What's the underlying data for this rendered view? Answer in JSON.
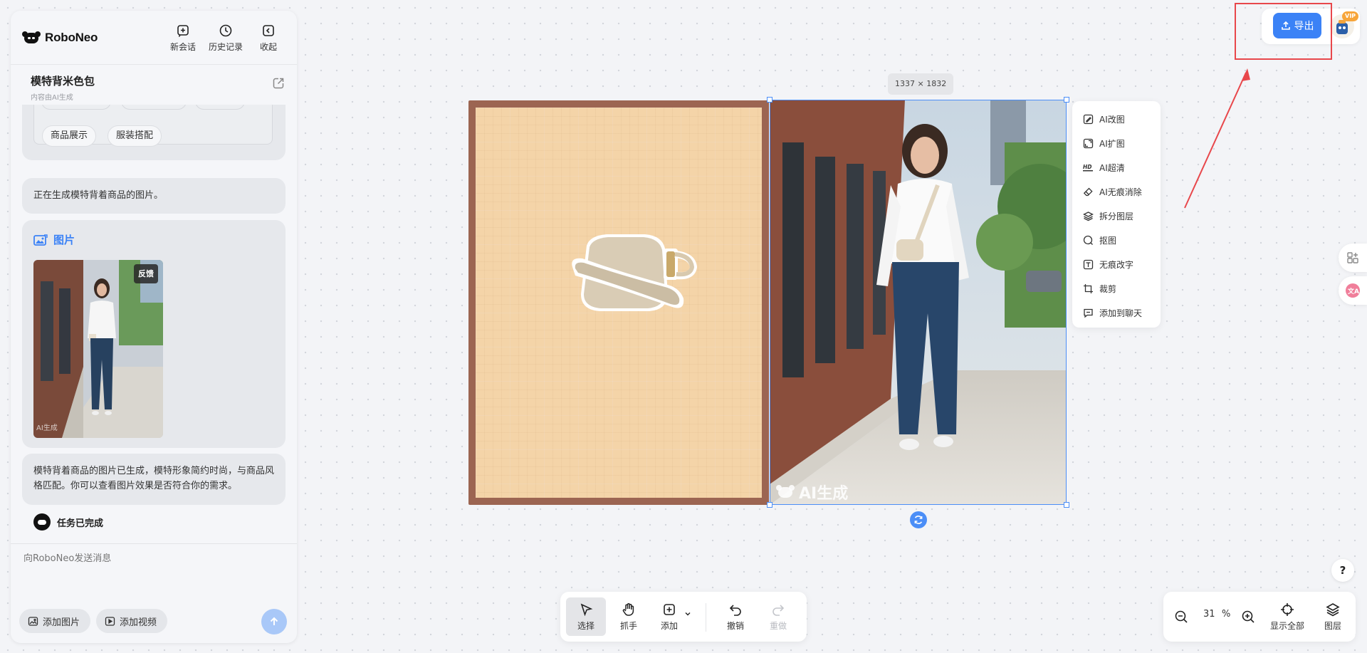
{
  "brand": {
    "name": "RoboNeo"
  },
  "header": {
    "actions": [
      {
        "label": "新会话",
        "icon": "new-chat-icon"
      },
      {
        "label": "历史记录",
        "icon": "history-icon"
      },
      {
        "label": "收起",
        "icon": "collapse-icon"
      }
    ]
  },
  "conversation": {
    "title": "模特背米色包",
    "subtitle": "内容由AI生成"
  },
  "chat": {
    "tags": [
      "商品展示",
      "服装搭配"
    ],
    "generating_text": "正在生成模特背着商品的图片。",
    "image_card": {
      "title": "图片",
      "feedback_label": "反馈",
      "watermark": "AI生成"
    },
    "result_text": "模特背着商品的图片已生成，模特形象简约时尚，与商品风格匹配。你可以查看图片效果是否符合你的需求。",
    "task_done": "任务已完成"
  },
  "composer": {
    "placeholder": "向RoboNeo发送消息",
    "add_image": "添加图片",
    "add_video": "添加视频"
  },
  "canvas": {
    "size_label": "1337 × 1832",
    "watermark": "AI生成"
  },
  "context_menu": {
    "items": [
      {
        "label": "AI改图",
        "icon": "ai-edit-icon"
      },
      {
        "label": "AI扩图",
        "icon": "ai-expand-icon"
      },
      {
        "label": "AI超清",
        "icon": "hd-icon"
      },
      {
        "label": "AI无痕消除",
        "icon": "eraser-icon"
      },
      {
        "label": "拆分图层",
        "icon": "layers-split-icon"
      },
      {
        "label": "抠图",
        "icon": "cutout-icon"
      },
      {
        "label": "无痕改字",
        "icon": "text-edit-icon"
      },
      {
        "label": "裁剪",
        "icon": "crop-icon"
      },
      {
        "label": "添加到聊天",
        "icon": "add-to-chat-icon"
      }
    ]
  },
  "topbar": {
    "export_label": "导出",
    "vip_label": "VIP"
  },
  "toolbar": {
    "select": "选择",
    "hand": "抓手",
    "add": "添加",
    "undo": "撤销",
    "redo": "重做"
  },
  "zoom": {
    "value": "31",
    "unit": "%",
    "fit_all": "显示全部",
    "layers": "图层"
  },
  "help": {
    "label": "?"
  },
  "colors": {
    "accent": "#3b82f6",
    "annotation": "#e8474b"
  }
}
